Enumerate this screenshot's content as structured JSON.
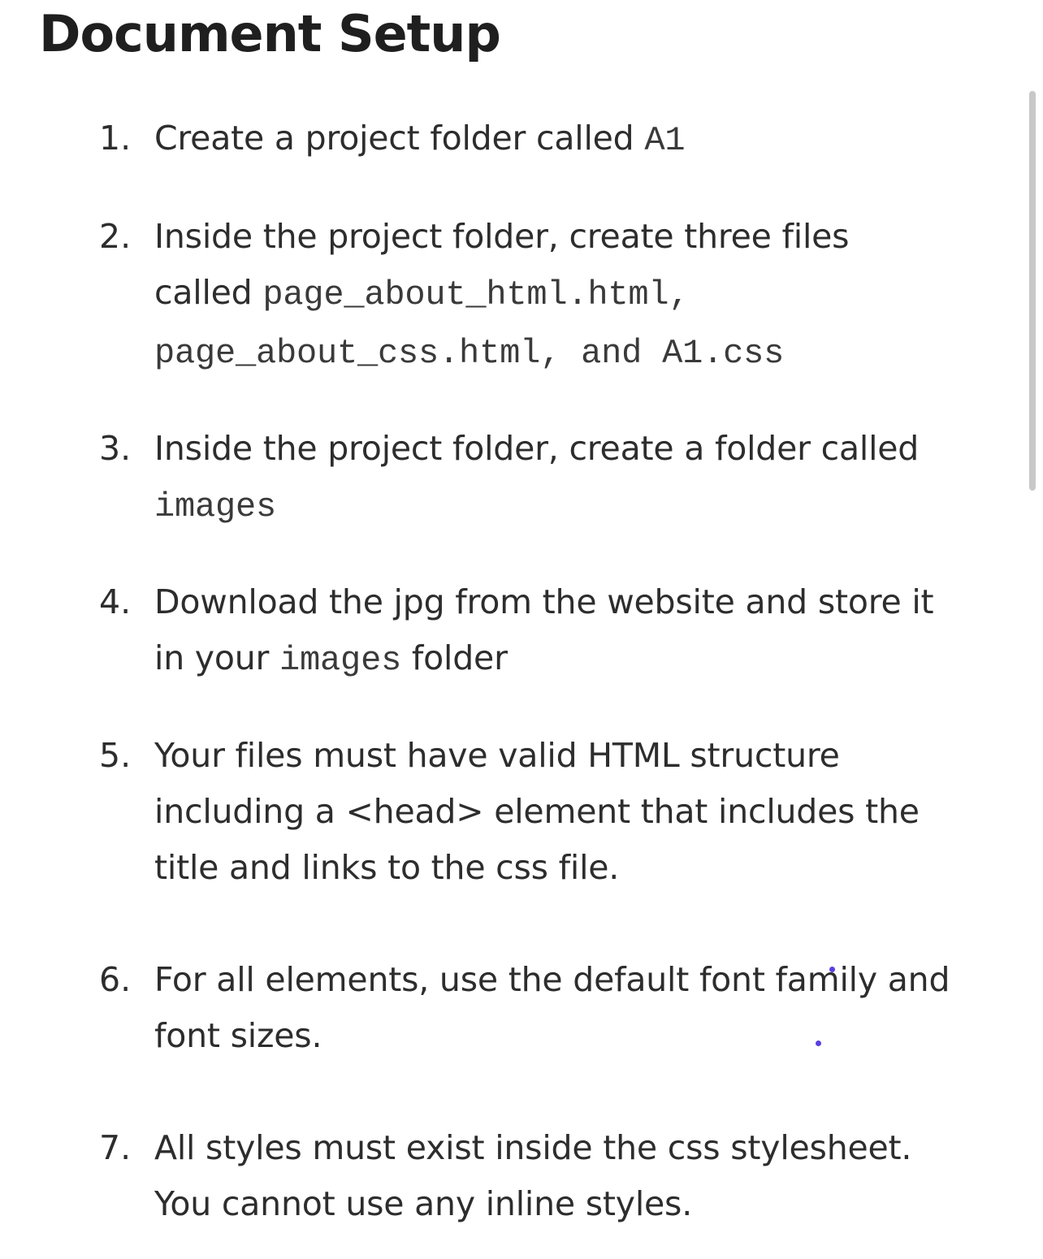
{
  "page": {
    "title": "Document Setup"
  },
  "steps": [
    {
      "number": "1.",
      "lines": [
        [
          {
            "text": "Create a project folder called "
          },
          {
            "code": "A1"
          }
        ]
      ]
    },
    {
      "number": "2.",
      "lines": [
        [
          {
            "text": "Inside the project folder, create three files"
          }
        ],
        [
          {
            "text": "called "
          },
          {
            "code": "page_about_html.html,"
          }
        ],
        [
          {
            "code": "page_about_css.html, and A1.css"
          }
        ]
      ]
    },
    {
      "number": "3.",
      "lines": [
        [
          {
            "text": "Inside the project folder, create a folder called"
          }
        ],
        [
          {
            "code": "images"
          }
        ]
      ]
    },
    {
      "number": "4.",
      "lines": [
        [
          {
            "text": "Download the jpg from the website and store it"
          }
        ],
        [
          {
            "text": "in your "
          },
          {
            "code": "images"
          },
          {
            "text": " folder"
          }
        ]
      ]
    },
    {
      "number": "5.",
      "lines": [
        [
          {
            "text": "Your files must have valid HTML structure"
          }
        ],
        [
          {
            "text": "including a <head> element that includes the"
          }
        ],
        [
          {
            "text": "title and links to the css file."
          }
        ]
      ]
    },
    {
      "number": "6.",
      "lines": [
        [
          {
            "text": "For all elements, use the default font family and"
          }
        ],
        [
          {
            "text": "font sizes."
          }
        ]
      ]
    },
    {
      "number": "7.",
      "lines": [
        [
          {
            "text": "All styles must exist inside the css stylesheet."
          }
        ],
        [
          {
            "text": "You cannot use any inline styles."
          }
        ]
      ]
    }
  ],
  "colors": {
    "text": "#2d2d2d",
    "title": "#1f1f1f",
    "code": "#3a3a3a",
    "scrollbar": "#c8c8c8",
    "cursor_dot": "#5a3fe0"
  }
}
